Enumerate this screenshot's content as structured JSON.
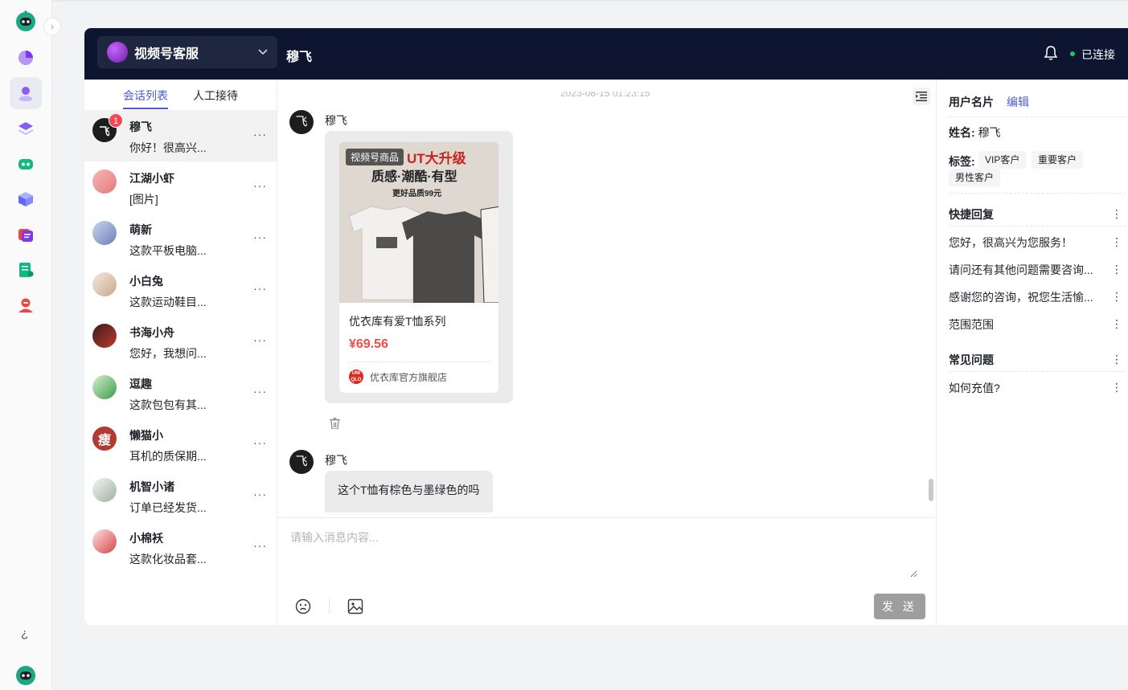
{
  "header": {
    "account_name": "视频号客服",
    "chat_title": "穆飞",
    "status": "已连接"
  },
  "tabs": [
    {
      "label": "会话列表"
    },
    {
      "label": "人工接待"
    }
  ],
  "conversations": [
    {
      "name": "穆飞",
      "preview": "你好！很高兴...",
      "avatar_text": "飞",
      "badge": "1",
      "more": "···"
    },
    {
      "name": "江湖小虾",
      "preview": "[图片]",
      "avatar_text": "",
      "more": "···"
    },
    {
      "name": "萌新",
      "preview": "这款平板电脑...",
      "avatar_text": "",
      "more": "···"
    },
    {
      "name": "小白兔",
      "preview": "这款运动鞋目...",
      "avatar_text": "",
      "more": "···"
    },
    {
      "name": "书海小舟",
      "preview": "您好，我想问...",
      "avatar_text": "",
      "more": "···"
    },
    {
      "name": "逗趣",
      "preview": "这款包包有其...",
      "avatar_text": "",
      "more": "···"
    },
    {
      "name": "懒猫小",
      "preview": "耳机的质保期...",
      "avatar_text": "瘦",
      "more": "···"
    },
    {
      "name": "机智小诸",
      "preview": "订单已经发货...",
      "avatar_text": "",
      "more": "···"
    },
    {
      "name": "小棉袄",
      "preview": "这款化妆品套...",
      "avatar_text": "",
      "more": "···"
    }
  ],
  "chat": {
    "timestamp": "2023-08-15 01:23:15",
    "messages": [
      {
        "sender": "穆飞",
        "avatar_text": "飞",
        "product": {
          "tag": "视频号商品",
          "headline": "UT大升级",
          "sub1": "质感·潮酷·有型",
          "sub2": "更好品质99元",
          "name": "优衣库有爱T恤系列",
          "price": "¥69.56",
          "shop_logo": "UNI QLO",
          "shop": "优衣库官方旗舰店"
        }
      },
      {
        "sender": "穆飞",
        "avatar_text": "飞",
        "text": "这个T恤有棕色与墨绿色的吗"
      }
    ]
  },
  "composer": {
    "placeholder": "请输入消息内容...",
    "send_label": "发 送"
  },
  "side": {
    "card_title": "用户名片",
    "edit_label": "编辑",
    "name_label": "姓名:",
    "name_value": "穆飞",
    "tags_label": "标签:",
    "tags": [
      "VIP客户",
      "重要客户",
      "男性客户"
    ],
    "quick_reply_title": "快捷回复",
    "quick_replies": [
      "您好，很高兴为您服务！",
      "请问还有其他问题需要咨询...",
      "感谢您的咨询，祝您生活愉...",
      "范围范围"
    ],
    "faq_title": "常见问题",
    "faqs": [
      "如何充值?"
    ],
    "kebab": "⋮"
  },
  "rail": {
    "collapse_glyph": "›",
    "bottom_glyph": "¿"
  },
  "colors": {
    "header_bg": "#0d1530",
    "accent": "#4c59d6",
    "price": "#f04b4b",
    "online": "#22c55e",
    "badge": "#f5464f"
  }
}
